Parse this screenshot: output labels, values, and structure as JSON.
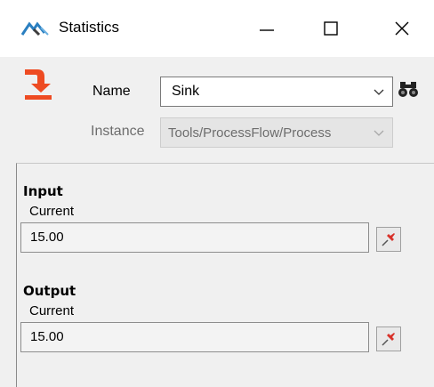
{
  "window": {
    "title": "Statistics",
    "app_icon": "flexsim-logo-icon",
    "controls": [
      "minimize-icon",
      "maximize-icon",
      "close-icon"
    ]
  },
  "header": {
    "object_icon": "sink-arrow-icon",
    "name_label": "Name",
    "name_value": "Sink",
    "instance_label": "Instance",
    "instance_value": "Tools/ProcessFlow/Process"
  },
  "groups": [
    {
      "title": "Input",
      "subtitle": "Current",
      "value": "15.00"
    },
    {
      "title": "Output",
      "subtitle": "Current",
      "value": "15.00"
    }
  ],
  "colors": {
    "accent": "#ee4b22",
    "pin": "#d8322a"
  }
}
